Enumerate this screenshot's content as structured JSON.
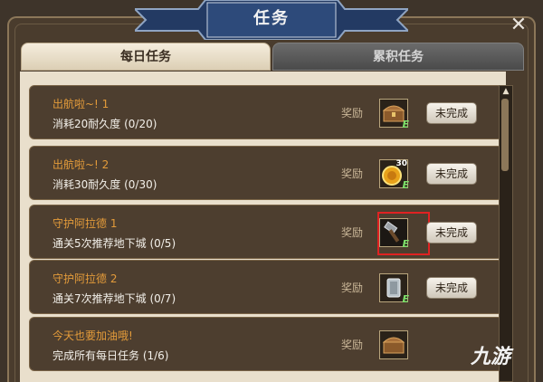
{
  "window": {
    "title": "任务"
  },
  "tabs": [
    {
      "label": "每日任务",
      "active": true
    },
    {
      "label": "累积任务",
      "active": false
    }
  ],
  "tasks": [
    {
      "title": "出航啦~! 1",
      "description": "消耗20耐久度 (0/20)",
      "reward_label": "奖励",
      "reward_icon": "treasure-chest-icon",
      "status": "未完成"
    },
    {
      "title": "出航啦~! 2",
      "description": "消耗30耐久度 (0/30)",
      "reward_label": "奖励",
      "reward_icon": "gold-coin-30-icon",
      "status": "未完成"
    },
    {
      "title": "守护阿拉德 1",
      "description": "通关5次推荐地下城 (0/5)",
      "reward_label": "奖励",
      "reward_icon": "hammer-icon",
      "status": "未完成"
    },
    {
      "title": "守护阿拉德 2",
      "description": "通关7次推荐地下城 (0/7)",
      "reward_label": "奖励",
      "reward_icon": "stone-tablet-icon",
      "status": "未完成"
    },
    {
      "title": "今天也要加油哦!",
      "description": "完成所有每日任务 (1/6)",
      "reward_label": "奖励",
      "reward_icon": "treasure-chest-icon"
    }
  ],
  "reward_badge": "30",
  "watermark": {
    "text": "九游"
  },
  "colors": {
    "task_title": "#e39b3a",
    "highlight": "#e02222",
    "panel_bg": "#4d3e2f"
  }
}
